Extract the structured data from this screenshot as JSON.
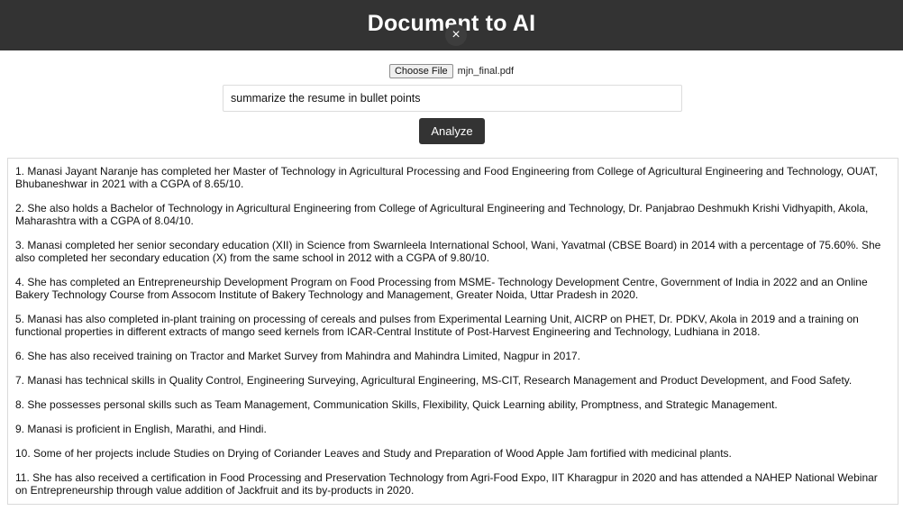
{
  "header": {
    "title": "Document to AI",
    "close_label": "×"
  },
  "upload": {
    "choose_label": "Choose File",
    "file_name": "mjn_final.pdf"
  },
  "prompt": {
    "value": "summarize the resume in bullet points"
  },
  "analyze_label": "Analyze",
  "result": {
    "items": [
      "1. Manasi Jayant Naranje has completed her Master of Technology in Agricultural Processing and Food Engineering from College of Agricultural Engineering and Technology, OUAT, Bhubaneshwar in 2021 with a CGPA of 8.65/10.",
      "2. She also holds a Bachelor of Technology in Agricultural Engineering from College of Agricultural Engineering and Technology, Dr. Panjabrao Deshmukh Krishi Vidhyapith, Akola, Maharashtra with a CGPA of 8.04/10.",
      "3. Manasi completed her senior secondary education (XII) in Science from Swarnleela International School, Wani, Yavatmal (CBSE Board) in 2014 with a percentage of 75.60%. She also completed her secondary education (X) from the same school in 2012 with a CGPA of 9.80/10.",
      "4. She has completed an Entrepreneurship Development Program on Food Processing from MSME- Technology Development Centre, Government of India in 2022 and an Online Bakery Technology Course from Assocom Institute of Bakery Technology and Management, Greater Noida, Uttar Pradesh in 2020.",
      "5. Manasi has also completed in-plant training on processing of cereals and pulses from Experimental Learning Unit, AICRP on PHET, Dr. PDKV, Akola in 2019 and a training on functional properties in different extracts of mango seed kernels from ICAR-Central Institute of Post-Harvest Engineering and Technology, Ludhiana in 2018.",
      "6. She has also received training on Tractor and Market Survey from Mahindra and Mahindra Limited, Nagpur in 2017.",
      "7. Manasi has technical skills in Quality Control, Engineering Surveying, Agricultural Engineering, MS-CIT, Research Management and Product Development, and Food Safety.",
      "8. She possesses personal skills such as Team Management, Communication Skills, Flexibility, Quick Learning ability, Promptness, and Strategic Management.",
      "9. Manasi is proficient in English, Marathi, and Hindi.",
      "10. Some of her projects include Studies on Drying of Coriander Leaves and Study and Preparation of Wood Apple Jam fortified with medicinal plants.",
      "11. She has also received a certification in Food Processing and Preservation Technology from Agri-Food Expo, IIT Kharagpur in 2020 and has attended a NAHEP National Webinar on Entrepreneurship through value addition of Jackfruit and its by-products in 2020."
    ]
  }
}
